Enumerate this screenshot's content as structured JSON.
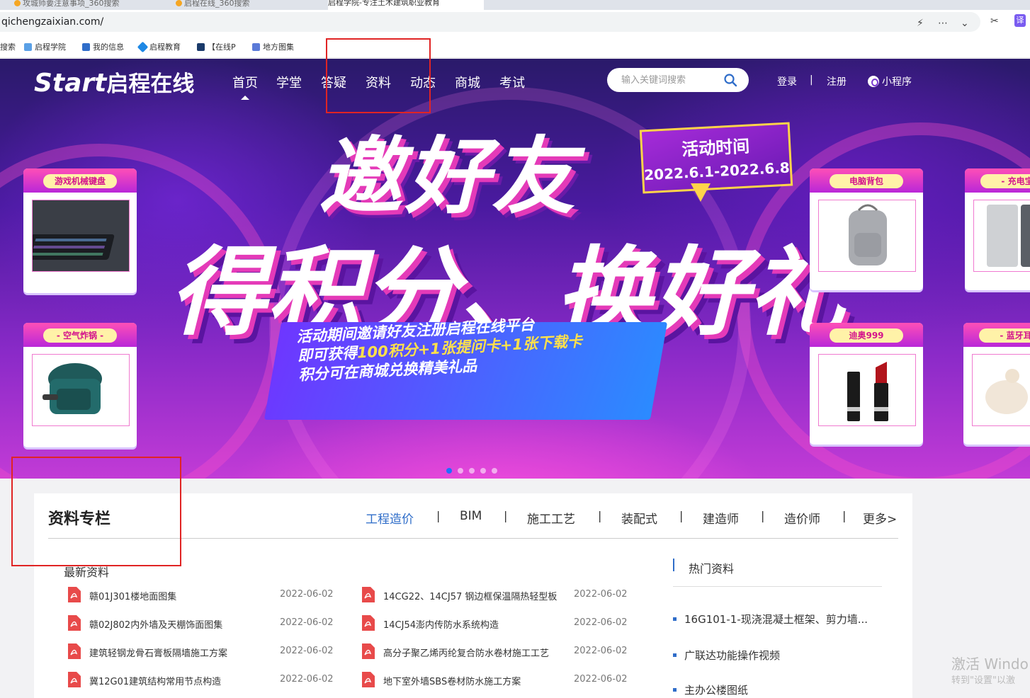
{
  "browser": {
    "tabs": [
      {
        "title": "攻城师要注意事项_360搜索"
      },
      {
        "title": "启程在线_360搜索"
      },
      {
        "title": "启程学院-专注土木建筑职业教育"
      }
    ],
    "url": "qichengzaixian.com/",
    "bookmarks": [
      {
        "label": "搜索"
      },
      {
        "label": "启程学院"
      },
      {
        "label": "我的信息"
      },
      {
        "label": "启程教育"
      },
      {
        "label": "【在线P"
      },
      {
        "label": "地方图集"
      }
    ]
  },
  "header": {
    "logo_latin": "Start",
    "logo_cn": "启程在线",
    "nav": [
      "首页",
      "学堂",
      "答疑",
      "资料",
      "动态",
      "商城",
      "考试"
    ],
    "search_placeholder": "输入关键词搜索",
    "login": "登录",
    "sep": "|",
    "register": "注册",
    "mini_program": "小程序"
  },
  "banner": {
    "headline1": "邀好友",
    "headline2": "得积分、换好礼",
    "time_title": "活动时间",
    "time_range": "2022.6.1-2022.6.8",
    "promo_line1": "活动期间邀请好友注册启程在线平台",
    "promo_line2_a": "即可获得",
    "promo_line2_b": "100积分+1张提问卡+1张下载卡",
    "promo_line3": "积分可在商城兑换精美礼品",
    "prizes": [
      {
        "label": "游戏机械键盘"
      },
      {
        "label": "- 空气炸锅 -"
      },
      {
        "label": "电脑背包"
      },
      {
        "label": "迪奥999"
      },
      {
        "label": "- 充电宝"
      },
      {
        "label": "- 蓝牙耳"
      }
    ],
    "dots_total": 5,
    "dots_active": 1
  },
  "section": {
    "title": "资料专栏",
    "tabs": [
      "工程造价",
      "BIM",
      "施工工艺",
      "装配式",
      "建造师",
      "造价师",
      "更多>"
    ],
    "tab_sep": "|",
    "latest_label": "最新资料",
    "docs_left": [
      {
        "title": "赣01J301楼地面图集",
        "date": "2022-06-02"
      },
      {
        "title": "赣02J802内外墙及天棚饰面图集",
        "date": "2022-06-02"
      },
      {
        "title": "建筑轻钢龙骨石膏板隔墙施工方案",
        "date": "2022-06-02"
      },
      {
        "title": "冀12G01建筑结构常用节点构造",
        "date": "2022-06-02"
      }
    ],
    "docs_right": [
      {
        "title": "14CG22、14CJ57 钢边框保温隔热轻型板",
        "date": "2022-06-02"
      },
      {
        "title": "14CJ54澎内传防水系统构造",
        "date": "2022-06-02"
      },
      {
        "title": "高分子聚乙烯丙纶复合防水卷材施工工艺",
        "date": "2022-06-02"
      },
      {
        "title": "地下室外墙SBS卷材防水施工方案",
        "date": "2022-06-02"
      }
    ],
    "hot_label": "热门资料",
    "hot_items": [
      "16G101-1-现浇混凝土框架、剪力墙...",
      "广联达功能操作视频",
      "主办公楼图纸"
    ]
  },
  "watermark": {
    "line1": "激活 Windo",
    "line2": "转到\"设置\"以激"
  },
  "colors": {
    "accent": "#2f6dc9",
    "annotation_red": "#e02424",
    "banner_purple": "#4a1aa0"
  }
}
